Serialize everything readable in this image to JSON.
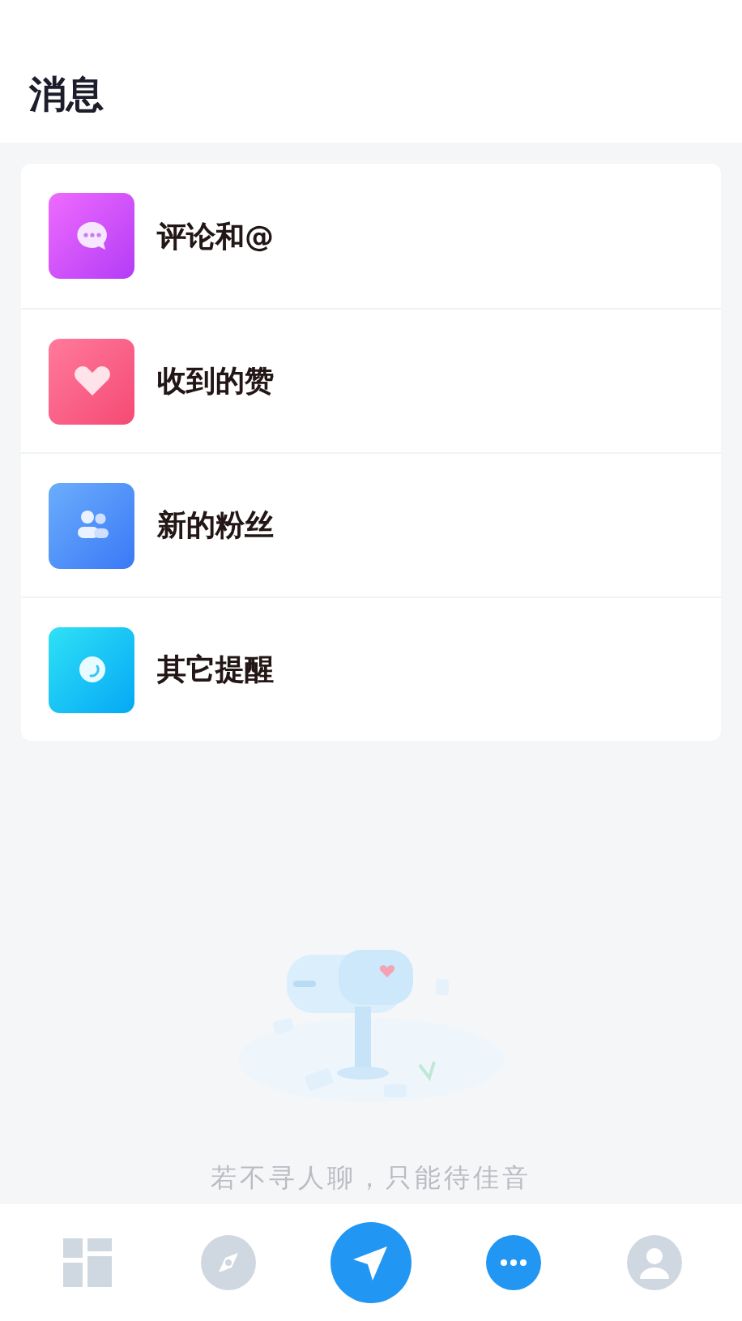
{
  "header": {
    "title": "消息"
  },
  "items": [
    {
      "kind": "comment",
      "label": "评论和@"
    },
    {
      "kind": "like",
      "label": "收到的赞"
    },
    {
      "kind": "fans",
      "label": "新的粉丝"
    },
    {
      "kind": "other",
      "label": "其它提醒"
    }
  ],
  "empty_state": {
    "kind": "picture",
    "message": "若不寻人聊，只能待佳音"
  },
  "tab_bar": [
    {
      "kind": "home",
      "selected": false
    },
    {
      "kind": "discover",
      "selected": false
    },
    {
      "kind": "post",
      "selected": false
    },
    {
      "kind": "messages",
      "selected": true
    },
    {
      "kind": "profile",
      "selected": false
    }
  ]
}
